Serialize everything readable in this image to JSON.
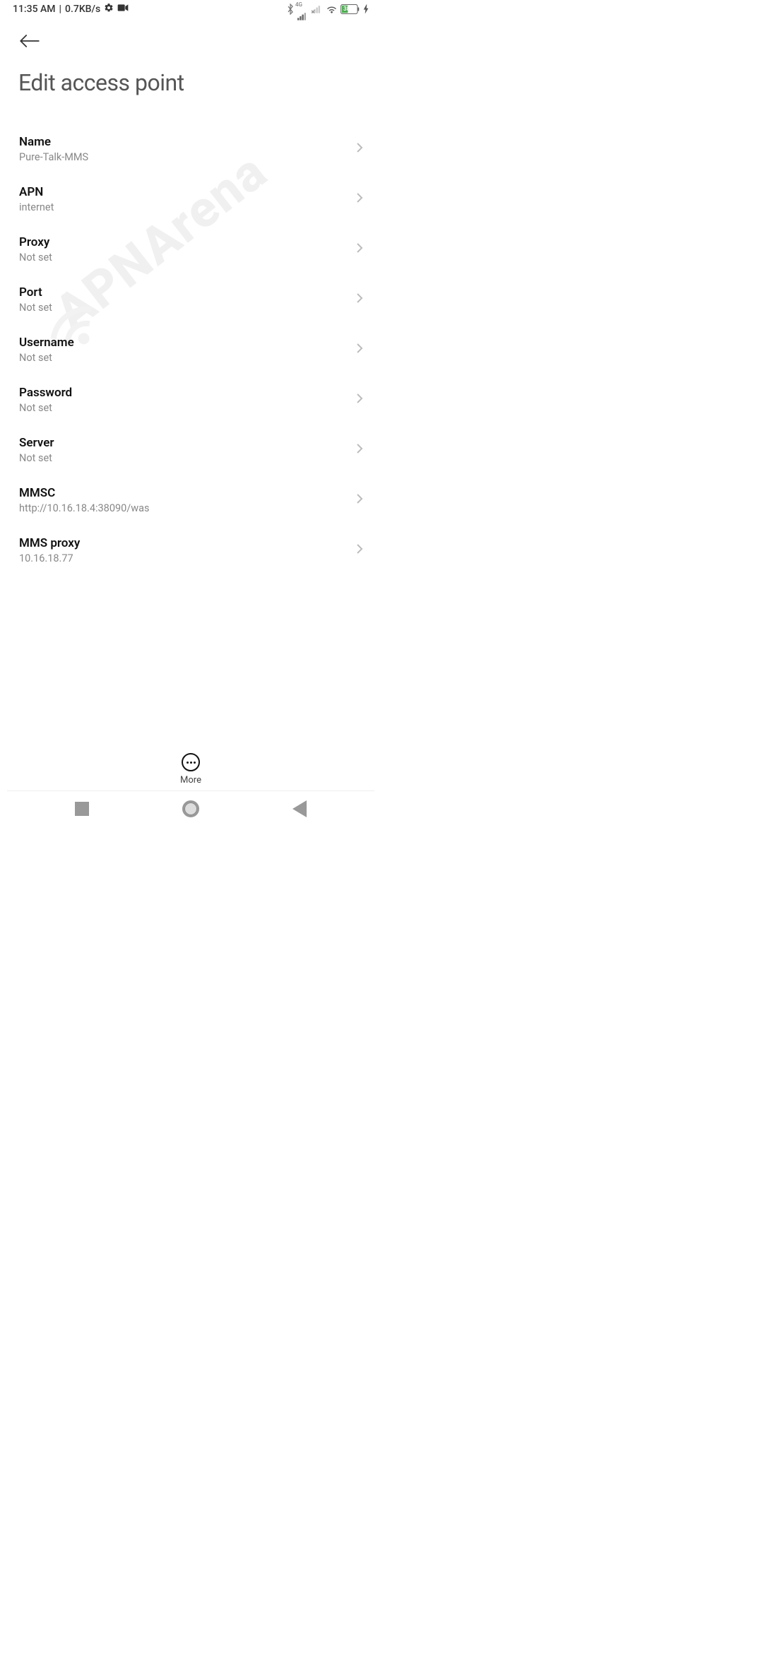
{
  "status_bar": {
    "time": "11:35 AM",
    "separator": " | ",
    "data_rate": "0.7KB/s",
    "network_label": "4G",
    "battery_percent": "38"
  },
  "header": {
    "title": "Edit access point"
  },
  "settings": [
    {
      "title": "Name",
      "value": "Pure-Talk-MMS"
    },
    {
      "title": "APN",
      "value": "internet"
    },
    {
      "title": "Proxy",
      "value": "Not set"
    },
    {
      "title": "Port",
      "value": "Not set"
    },
    {
      "title": "Username",
      "value": "Not set"
    },
    {
      "title": "Password",
      "value": "Not set"
    },
    {
      "title": "Server",
      "value": "Not set"
    },
    {
      "title": "MMSC",
      "value": "http://10.16.18.4:38090/was"
    },
    {
      "title": "MMS proxy",
      "value": "10.16.18.77"
    }
  ],
  "bottom": {
    "more_label": "More"
  },
  "watermark": "APNArena"
}
